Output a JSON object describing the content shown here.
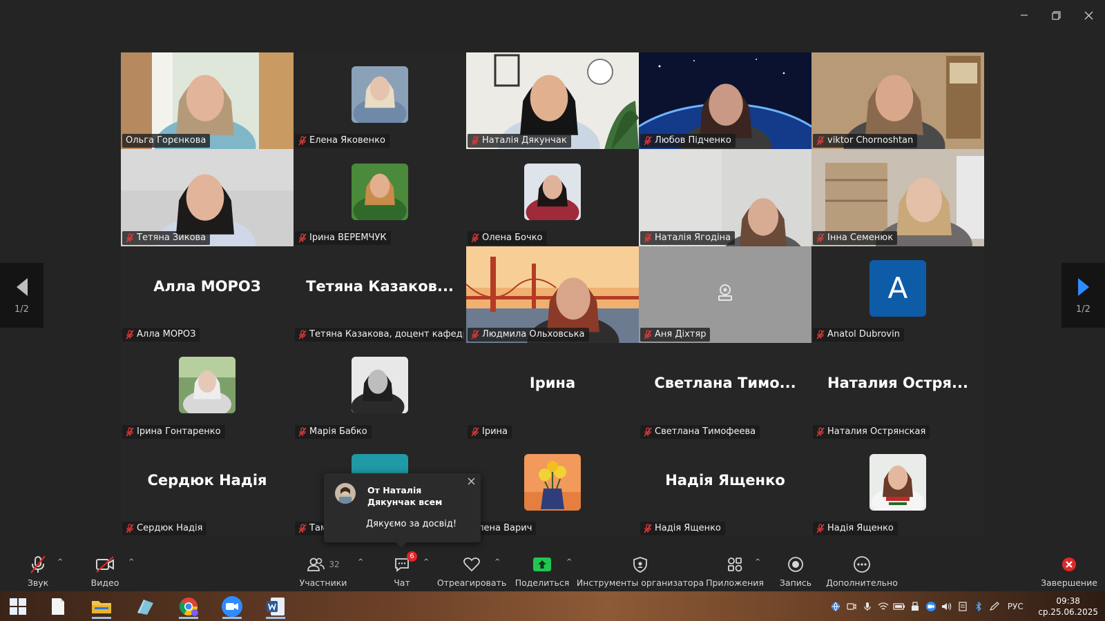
{
  "window": {
    "controls": [
      "minimize",
      "restore",
      "close"
    ]
  },
  "participants": [
    {
      "name": "Ольга Горєнкова",
      "view": "video",
      "scene": "room-light",
      "muted": false
    },
    {
      "name": "Елена Яковенко",
      "view": "photo",
      "photo": "blonde"
    },
    {
      "name": "Наталія Дякунчак",
      "view": "video",
      "scene": "office"
    },
    {
      "name": "Любов Підченко",
      "view": "video",
      "scene": "space"
    },
    {
      "name": "viktor Chornoshtan",
      "view": "video",
      "scene": "room-warm"
    },
    {
      "name": "Тетяна Зикова",
      "view": "video",
      "scene": "room-gray"
    },
    {
      "name": "Ірина ВЕРЕМЧУК",
      "view": "photo",
      "photo": "green"
    },
    {
      "name": "Олена Бочко",
      "view": "photo",
      "photo": "dark"
    },
    {
      "name": "Наталія Ягодіна",
      "view": "video",
      "scene": "wall"
    },
    {
      "name": "Інна Семенюк",
      "view": "video",
      "scene": "shelves",
      "speaking": true
    },
    {
      "name": "Алла МОРОЗ",
      "view": "name",
      "display": "Алла МОРОЗ"
    },
    {
      "name": "Тетяна Казакова, доцент кафедри ж...",
      "view": "name",
      "display": "Тетяна Казаков..."
    },
    {
      "name": "Людмила Ольховська",
      "view": "video",
      "scene": "bridge"
    },
    {
      "name": "Аня Діхтяр",
      "view": "novideo"
    },
    {
      "name": "Anatol Dubrovin",
      "view": "letter",
      "letter": "A"
    },
    {
      "name": "Ірина Гонтаренко",
      "view": "photo",
      "photo": "garden"
    },
    {
      "name": "Марія Бабко",
      "view": "photo",
      "photo": "bw"
    },
    {
      "name": "Ірина",
      "view": "name",
      "display": "Ірина"
    },
    {
      "name": "Светлана Тимофеева",
      "view": "name",
      "display": "Светлана Тимо..."
    },
    {
      "name": "Наталия Острянская",
      "view": "name",
      "display": "Наталия Остря..."
    },
    {
      "name": "Сердюк Надія",
      "view": "name",
      "display": "Сердюк Надія"
    },
    {
      "name": "Там",
      "view": "photo",
      "photo": "teal"
    },
    {
      "name": "Олена Варич",
      "view": "photo",
      "photo": "flowers",
      "muted": false
    },
    {
      "name": "Надія Ященко",
      "view": "name",
      "display": "Надія Ященко"
    },
    {
      "name": "Надія Ященко",
      "view": "photo",
      "photo": "embroidery"
    }
  ],
  "pagination": {
    "left": "1/2",
    "right": "1/2"
  },
  "chat_popup": {
    "from": "От Наталія Дякунчак всем",
    "message": "Дякуємо за досвід!"
  },
  "toolbar": {
    "audio": "Звук",
    "video": "Видео",
    "participants": "Участники",
    "participants_count": "32",
    "chat": "Чат",
    "chat_badge": "6",
    "react": "Отреагировать",
    "share": "Поделиться",
    "host_tools": "Инструменты организатора",
    "apps": "Приложения",
    "record": "Запись",
    "more": "Дополнительно",
    "end": "Завершение"
  },
  "taskbar": {
    "apps": [
      "windows-start",
      "notepad",
      "file-explorer",
      "ruler-app",
      "chrome",
      "zoom",
      "word"
    ],
    "lang": "РУС",
    "time": "09:38",
    "date": "ср.25.06.2025"
  },
  "colors": {
    "speaking_border": "#23d959",
    "share_green": "#23c552",
    "badge_red": "#e02828",
    "end_red": "#e02828"
  }
}
